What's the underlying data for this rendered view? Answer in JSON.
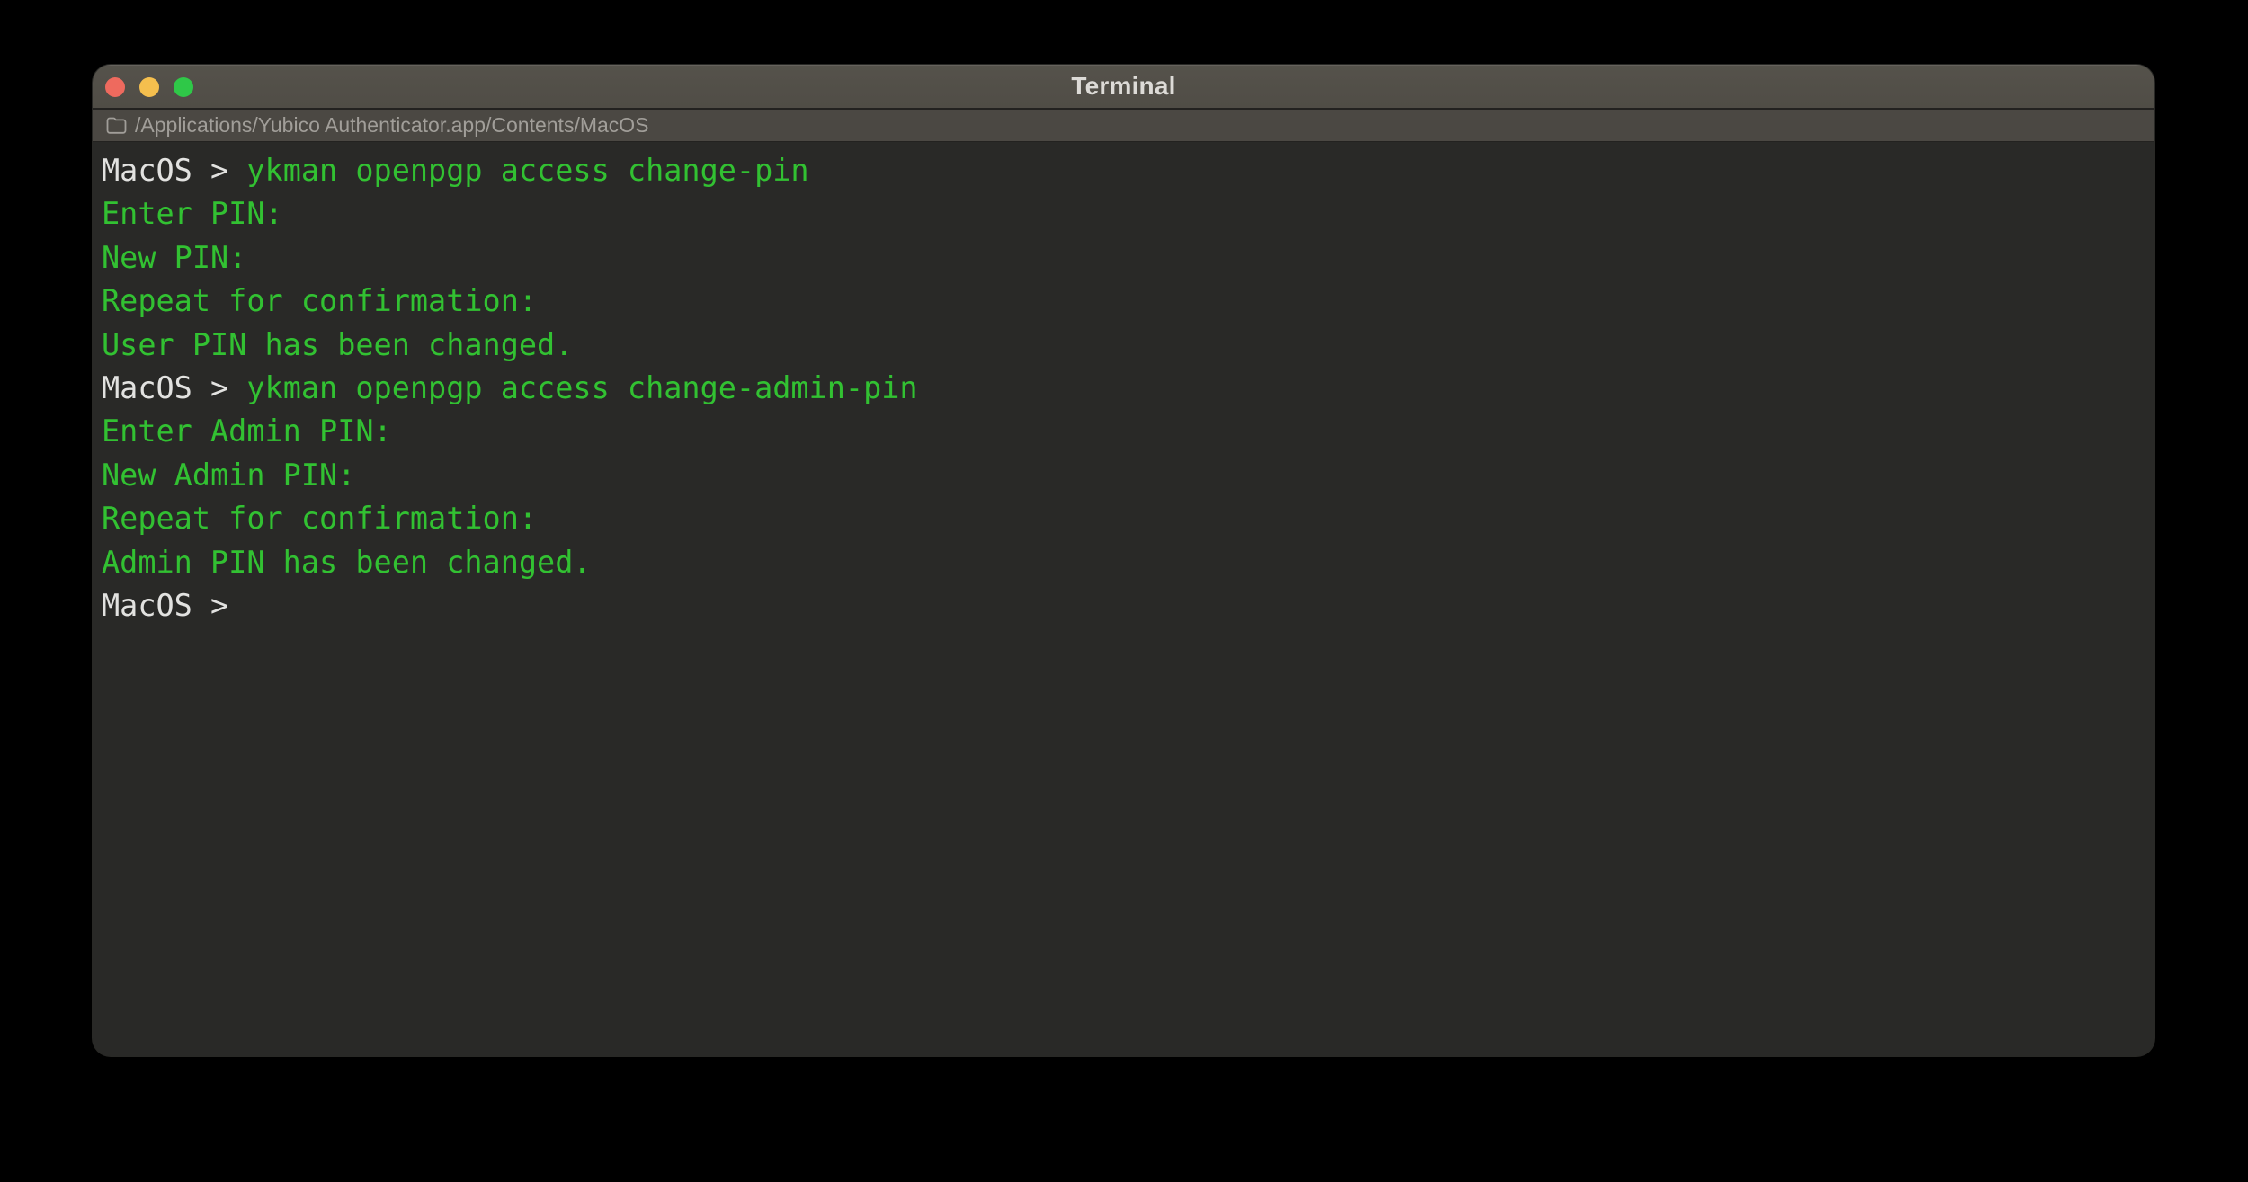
{
  "window": {
    "title": "Terminal",
    "traffic_lights": {
      "close_color": "#ee6a5e",
      "minimize_color": "#f5bf4e",
      "zoom_color": "#2fc848"
    },
    "path_bar": {
      "icon": "folder-icon",
      "path": "/Applications/Yubico Authenticator.app/Contents/MacOS"
    }
  },
  "terminal": {
    "colors": {
      "background": "#292927",
      "titlebar": "#55524b",
      "pathbar": "#4b4843",
      "title_text": "#dddbd7",
      "path_text": "#a19e99",
      "prompt_text": "#e2e2e0",
      "output_text": "#32c132"
    },
    "lines": [
      {
        "segments": [
          {
            "role": "prompt",
            "text": "MacOS > "
          },
          {
            "role": "command",
            "text": "ykman openpgp access change-pin"
          }
        ]
      },
      {
        "segments": [
          {
            "role": "output",
            "text": "Enter PIN:"
          }
        ]
      },
      {
        "segments": [
          {
            "role": "output",
            "text": "New PIN:"
          }
        ]
      },
      {
        "segments": [
          {
            "role": "output",
            "text": "Repeat for confirmation:"
          }
        ]
      },
      {
        "segments": [
          {
            "role": "output",
            "text": "User PIN has been changed."
          }
        ]
      },
      {
        "segments": [
          {
            "role": "prompt",
            "text": "MacOS > "
          },
          {
            "role": "command",
            "text": "ykman openpgp access change-admin-pin"
          }
        ]
      },
      {
        "segments": [
          {
            "role": "output",
            "text": "Enter Admin PIN:"
          }
        ]
      },
      {
        "segments": [
          {
            "role": "output",
            "text": "New Admin PIN:"
          }
        ]
      },
      {
        "segments": [
          {
            "role": "output",
            "text": "Repeat for confirmation:"
          }
        ]
      },
      {
        "segments": [
          {
            "role": "output",
            "text": "Admin PIN has been changed."
          }
        ]
      },
      {
        "segments": [
          {
            "role": "prompt",
            "text": "MacOS >"
          }
        ]
      }
    ]
  }
}
